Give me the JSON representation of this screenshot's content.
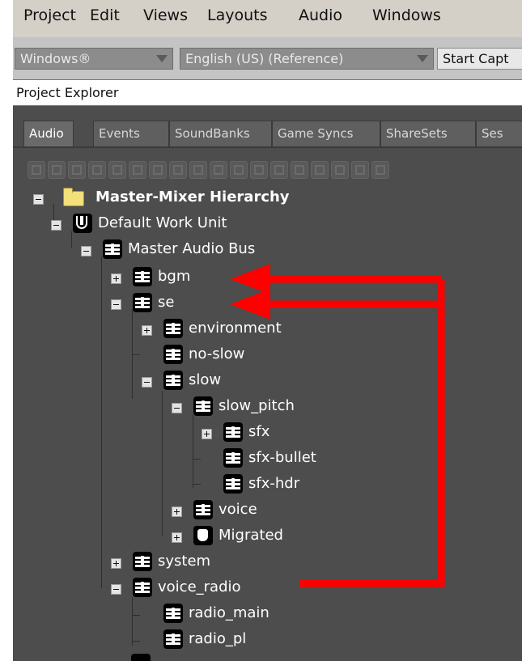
{
  "menu": [
    "Project",
    "Edit",
    "Views",
    "Layouts",
    "Audio",
    "Windows"
  ],
  "toolbar": {
    "platform": "Windows®",
    "language": "English (US) (Reference)",
    "capture": "Start Capt"
  },
  "explorer": {
    "title": "Project Explorer"
  },
  "tabs": [
    "Audio",
    "Events",
    "SoundBanks",
    "Game Syncs",
    "ShareSets",
    "Ses"
  ],
  "active_tab": "Audio",
  "tree": {
    "root": "Master-Mixer Hierarchy",
    "work_unit": "Default Work Unit",
    "master_bus": "Master Audio Bus",
    "bgm": "bgm",
    "se": "se",
    "environment": "environment",
    "no_slow": "no-slow",
    "slow": "slow",
    "slow_pitch": "slow_pitch",
    "sfx": "sfx",
    "sfx_bullet": "sfx-bullet",
    "sfx_hdr": "sfx-hdr",
    "voice": "voice",
    "migrated": "Migrated",
    "system": "system",
    "voice_radio": "voice_radio",
    "radio_main": "radio_main",
    "radio_pl": "radio_pl"
  },
  "colors": {
    "panel_bg": "#4d4d4d",
    "annotation": "#ff0000"
  },
  "icons": {
    "bus": "audio-bus-icon",
    "work_unit": "work-unit-icon",
    "folder": "folder-icon",
    "migrated": "migrated-bus-icon"
  }
}
